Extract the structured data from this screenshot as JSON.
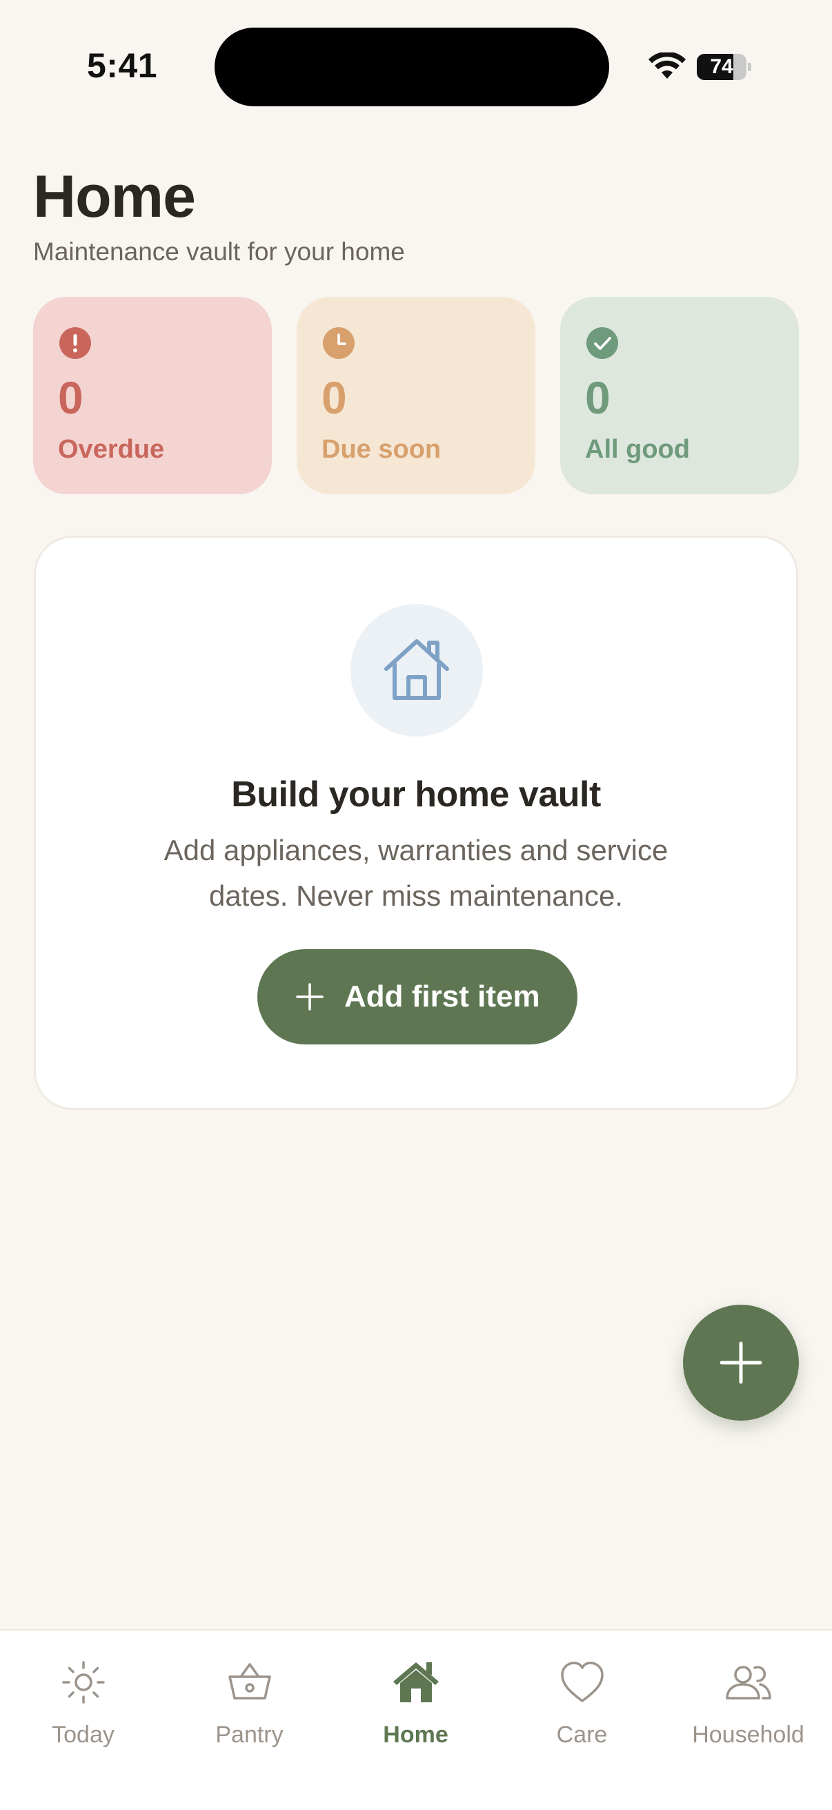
{
  "status_bar": {
    "time": "5:41",
    "battery_percent": "74",
    "battery_level": 0.74,
    "icons": [
      "wifi-icon",
      "battery-icon"
    ]
  },
  "header": {
    "title": "Home",
    "subtitle": "Maintenance vault for your home"
  },
  "stats": {
    "overdue": {
      "value": "0",
      "label": "Overdue",
      "icon": "alert-icon",
      "color": "#c9665c",
      "background": "#f4d4d1"
    },
    "due_soon": {
      "value": "0",
      "label": "Due soon",
      "icon": "clock-icon",
      "color": "#d7a06c",
      "background": "#f6e7d5"
    },
    "all_good": {
      "value": "0",
      "label": "All good",
      "icon": "check-icon",
      "color": "#6f9a7c",
      "background": "#dde7de"
    }
  },
  "empty_state": {
    "icon": "house-icon",
    "title": "Build your home vault",
    "description": "Add appliances, warranties and service dates. Never miss maintenance.",
    "button_label": "Add first item"
  },
  "fab": {
    "icon": "plus-icon"
  },
  "tab_bar": {
    "active": "Home",
    "items": [
      {
        "label": "Today",
        "icon": "sun-icon"
      },
      {
        "label": "Pantry",
        "icon": "basket-icon"
      },
      {
        "label": "Home",
        "icon": "house-filled-icon"
      },
      {
        "label": "Care",
        "icon": "heart-icon"
      },
      {
        "label": "Household",
        "icon": "people-icon"
      }
    ]
  },
  "colors": {
    "accent": "#5e7752",
    "background": "#f9f6f1",
    "text_primary": "#2b2722",
    "text_secondary": "#6b655d",
    "tab_inactive": "#9c948b"
  }
}
